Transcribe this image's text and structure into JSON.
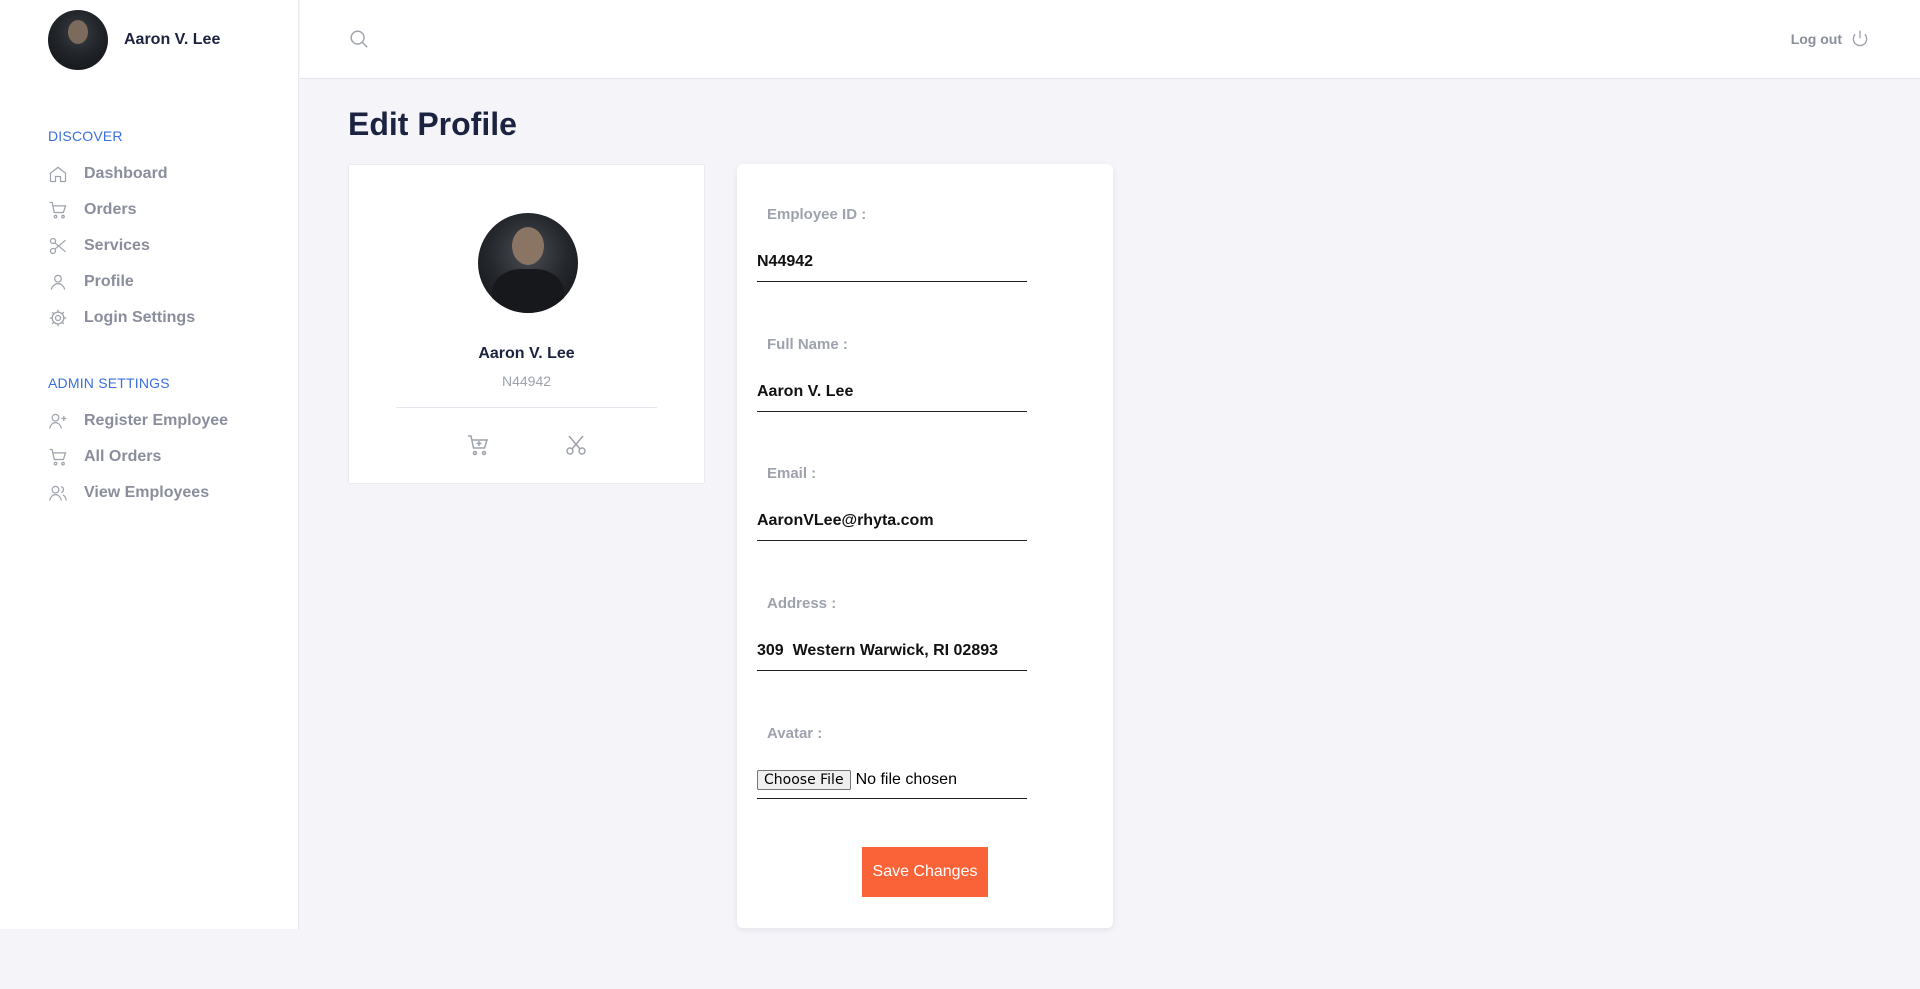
{
  "user": {
    "name": "Aaron V. Lee",
    "employee_id": "N44942"
  },
  "sidebar": {
    "discover_title": "DISCOVER",
    "discover_items": [
      {
        "label": "Dashboard",
        "icon": "home-icon"
      },
      {
        "label": "Orders",
        "icon": "cart-icon"
      },
      {
        "label": "Services",
        "icon": "scissors-icon"
      },
      {
        "label": "Profile",
        "icon": "user-icon"
      },
      {
        "label": "Login Settings",
        "icon": "gear-icon"
      }
    ],
    "admin_title": "ADMIN SETTINGS",
    "admin_items": [
      {
        "label": "Register Employee",
        "icon": "user-plus-icon"
      },
      {
        "label": "All Orders",
        "icon": "cart-icon"
      },
      {
        "label": "View Employees",
        "icon": "users-icon"
      }
    ]
  },
  "topbar": {
    "logout_label": "Log out"
  },
  "page": {
    "title": "Edit Profile"
  },
  "profile_card": {
    "name": "Aaron V. Lee",
    "id": "N44942"
  },
  "form": {
    "employee_id_label": "Employee ID :",
    "employee_id_value": "N44942",
    "full_name_label": "Full Name :",
    "full_name_value": "Aaron V. Lee",
    "email_label": "Email :",
    "email_value": "AaronVLee@rhyta.com",
    "address_label": "Address :",
    "address_value": "309  Western Warwick, RI 02893",
    "avatar_label": "Avatar :",
    "file_button": "Choose File",
    "file_status": "No file chosen",
    "save_label": "Save Changes"
  },
  "colors": {
    "accent": "#fa6338",
    "nav_title": "#3a6fe0",
    "heading": "#1c2340",
    "muted": "#9ea2ad"
  }
}
